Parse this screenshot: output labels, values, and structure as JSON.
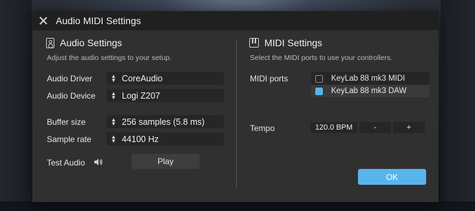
{
  "window": {
    "title": "Audio MIDI Settings"
  },
  "audio": {
    "heading": "Audio Settings",
    "subtitle": "Adjust the audio settings to your setup.",
    "driver": {
      "label": "Audio Driver",
      "value": "CoreAudio"
    },
    "device": {
      "label": "Audio Device",
      "value": "Logi Z207"
    },
    "buffer": {
      "label": "Buffer size",
      "value": "256 samples (5.8 ms)"
    },
    "rate": {
      "label": "Sample rate",
      "value": "44100 Hz"
    },
    "test": {
      "label": "Test Audio",
      "play_label": "Play"
    }
  },
  "midi": {
    "heading": "MIDI Settings",
    "subtitle": "Select the MIDI ports to use your controllers.",
    "ports_label": "MIDI ports",
    "ports": [
      {
        "name": "KeyLab 88 mk3 MIDI",
        "checked": false
      },
      {
        "name": "KeyLab 88 mk3 DAW",
        "checked": true
      }
    ],
    "tempo": {
      "label": "Tempo",
      "value": "120.0 BPM",
      "minus": "-",
      "plus": "+"
    }
  },
  "footer": {
    "ok_label": "OK"
  },
  "colors": {
    "accent": "#5ab4ec",
    "dialog_bg": "#303030",
    "titlebar_bg": "#202020"
  }
}
